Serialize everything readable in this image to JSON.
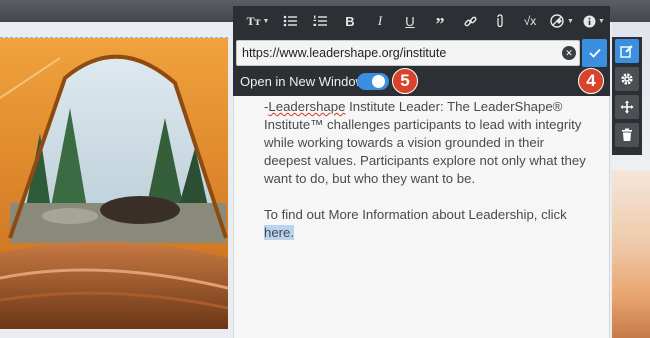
{
  "toolbar": {
    "buttons": [
      {
        "name": "text-style",
        "label": "Tт"
      },
      {
        "name": "bulleted-list",
        "label": ""
      },
      {
        "name": "numbered-list",
        "label": ""
      },
      {
        "name": "bold",
        "label": "B"
      },
      {
        "name": "italic",
        "label": "I"
      },
      {
        "name": "underline",
        "label": "U"
      },
      {
        "name": "quote",
        "label": "”"
      },
      {
        "name": "link",
        "label": ""
      },
      {
        "name": "attachment",
        "label": ""
      },
      {
        "name": "formula",
        "label": "√x"
      },
      {
        "name": "clear-format",
        "label": ""
      },
      {
        "name": "info",
        "label": ""
      }
    ]
  },
  "link_editor": {
    "url": "https://www.leadershape.org/institute",
    "open_new_window_label": "Open in New Window",
    "open_new_window": true
  },
  "badges": {
    "step_4": "4",
    "step_5": "5"
  },
  "content": {
    "p1_dash": "-",
    "p1_link_word": "Leadershape",
    "p1_rest": " Institute Leader: The LeaderShape® Institute™ challenges participants to lead with integrity while working towards a vision grounded in their deepest values. Participants explore not only what they want to do, but who they want to be.",
    "p2_text": "To find out More Information about Leadership, click ",
    "p2_link": "here."
  },
  "colors": {
    "toolbar_bg": "#2c2f33",
    "accent_blue": "#3b8fe0",
    "badge_red": "#d8432c"
  }
}
